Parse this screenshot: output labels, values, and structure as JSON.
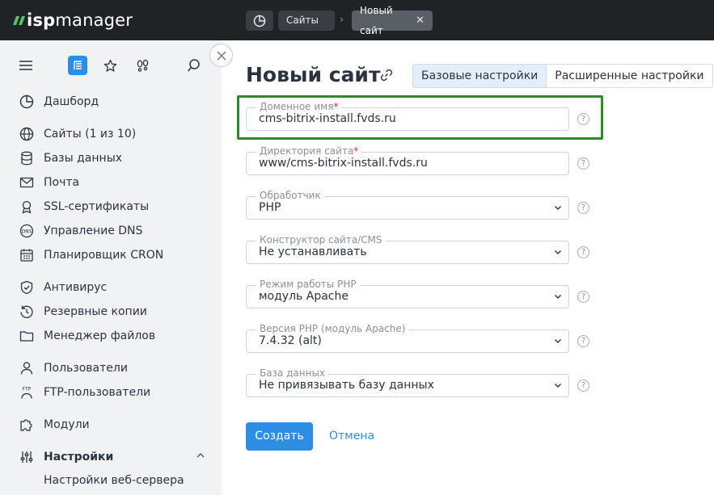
{
  "logo": {
    "part1": "isp",
    "part2": "manager"
  },
  "breadcrumbs": {
    "sites": "Сайты",
    "sep": "›",
    "current": "Новый сайт",
    "close": "✕"
  },
  "sidebar": {
    "items": [
      {
        "label": "Дашборд"
      },
      {
        "label": "Сайты (1 из 10)"
      },
      {
        "label": "Базы данных"
      },
      {
        "label": "Почта"
      },
      {
        "label": "SSL-сертификаты"
      },
      {
        "label": "Управление DNS"
      },
      {
        "label": "Планировщик CRON"
      },
      {
        "label": "Антивирус"
      },
      {
        "label": "Резервные копии"
      },
      {
        "label": "Менеджер файлов"
      },
      {
        "label": "Пользователи"
      },
      {
        "label": "FTP-пользователи"
      },
      {
        "label": "Модули"
      },
      {
        "label": "Настройки"
      }
    ],
    "sub_items": [
      {
        "label": "Настройки веб-сервера"
      }
    ]
  },
  "page": {
    "title": "Новый сайт"
  },
  "tabs": [
    {
      "label": "Базовые настройки"
    },
    {
      "label": "Расширенные настройки"
    }
  ],
  "form": {
    "fields": [
      {
        "label": "Доменное имя",
        "required": "*",
        "value": "cms-bitrix-install.fvds.ru"
      },
      {
        "label": "Директория сайта",
        "required": "*",
        "value": "www/cms-bitrix-install.fvds.ru"
      },
      {
        "label": "Обработчик",
        "value": "PHP"
      },
      {
        "label": "Конструктор сайта/CMS",
        "value": "Не устанавливать"
      },
      {
        "label": "Режим работы PHP",
        "value": "модуль Apache"
      },
      {
        "label": "Версия PHP (модуль Apache)",
        "value": "7.4.32 (alt)"
      },
      {
        "label": "База данных",
        "value": "Не привязывать базу данных"
      }
    ],
    "help": "?"
  },
  "actions": {
    "create": "Создать",
    "cancel": "Отмена"
  },
  "colors": {
    "accent": "#2f8de4",
    "highlight": "#2f8a2a",
    "topbar": "#202326",
    "sidebar": "#f1f2f4",
    "logo_mark": "#57c26b"
  }
}
